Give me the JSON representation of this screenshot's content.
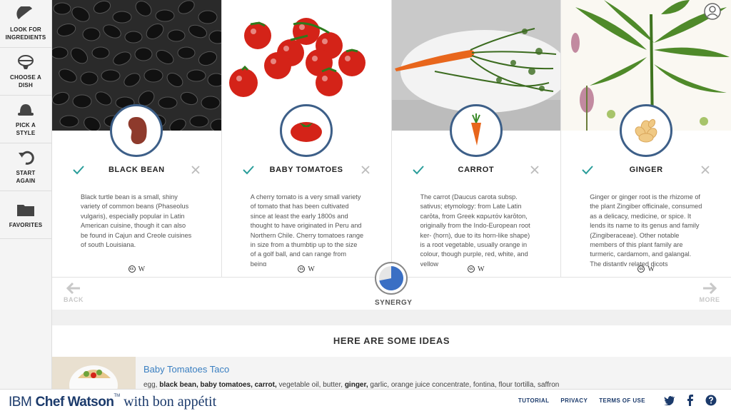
{
  "sidebar": {
    "items": [
      {
        "label": "LOOK FOR\nINGREDIENTS",
        "icon": "lemon-icon"
      },
      {
        "label": "CHOOSE A\nDISH",
        "icon": "dish-icon"
      },
      {
        "label": "PICK A\nSTYLE",
        "icon": "hat-icon"
      },
      {
        "label": "START\nAGAIN",
        "icon": "undo-icon"
      },
      {
        "label": "FAVORITES",
        "icon": "folder-icon"
      }
    ]
  },
  "cards": [
    {
      "title": "BLACK BEAN",
      "description": "Black turtle bean is a small, shiny variety of common beans (Phaseolus vulgaris), especially popular in Latin American cuisine, though it can also be found in Cajun and Creole cuisines of south Louisiana.",
      "icon": "bean-icon",
      "license": "cc",
      "source": "W"
    },
    {
      "title": "BABY TOMATOES",
      "description": "A cherry tomato is a very small variety of tomato that has been cultivated since at least the early 1800s and thought to have originated in Peru and Northern Chile. Cherry tomatoes range in size from a thumbtip up to the size of a golf ball, and can range from being",
      "icon": "tomato-icon",
      "license": "cc",
      "source": "W"
    },
    {
      "title": "CARROT",
      "description": "The carrot (Daucus carota subsp. sativus; etymology: from Late Latin carōta, from Greek καρωτόν karōton, originally from the Indo-European root ker- (horn), due to its horn-like shape) is a root vegetable, usually orange in colour, though purple, red, white, and yellow",
      "icon": "carrot-icon",
      "license": "cc",
      "source": "W"
    },
    {
      "title": "GINGER",
      "description": "Ginger or ginger root is the rhizome of the plant Zingiber officinale, consumed as a delicacy, medicine, or spice. It lends its name to its genus and family (Zingiberaceae). Other notable members of this plant family are turmeric, cardamom, and galangal. The distantly related dicots",
      "icon": "ginger-icon",
      "license": "cc",
      "source": "W"
    }
  ],
  "nav": {
    "back": "BACK",
    "more": "MORE",
    "synergy": "SYNERGY",
    "synergy_level": 0.72
  },
  "ideas": {
    "heading": "HERE ARE SOME IDEAS",
    "items": [
      {
        "title": "Baby Tomatoes Taco",
        "ingredients_bold": [
          "black bean",
          "baby tomatoes",
          "carrot",
          "ginger"
        ],
        "ing_1": "egg, ",
        "ing_2": "black bean, baby tomatoes, carrot,",
        "ing_3": " vegetable oil, butter, ",
        "ing_4": "ginger,",
        "ing_5": " garlic, orange juice concentrate, fontina, flour tortilla, saffron"
      }
    ]
  },
  "footer": {
    "brand_ibm": "IBM",
    "brand_chef": "Chef Watson",
    "brand_tm": "TM",
    "brand_with": " with ",
    "brand_ba": "bon appétit",
    "links": [
      "TUTORIAL",
      "PRIVACY",
      "TERMS OF USE"
    ]
  },
  "colors": {
    "accent_blue": "#3d5f88",
    "check_teal": "#2a9d9a",
    "link_blue": "#3a7fc1",
    "brand_navy": "#1b3a6b"
  }
}
